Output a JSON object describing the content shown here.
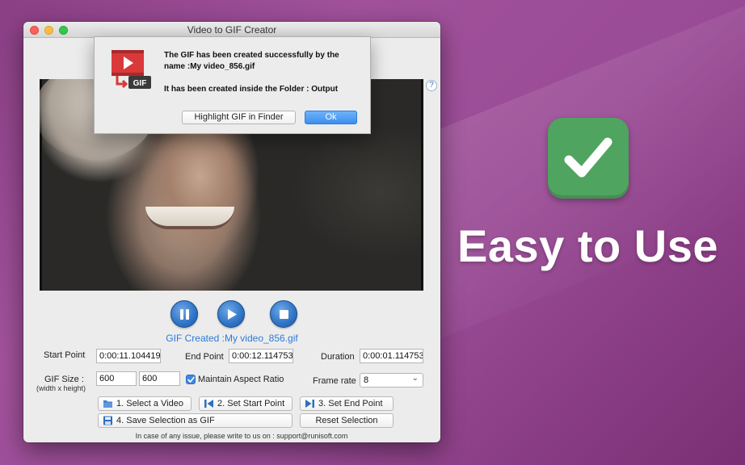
{
  "promo": {
    "title": "Easy to Use",
    "check_color": "#4fa45f",
    "icon": "checkmark-icon"
  },
  "window": {
    "title": "Video to GIF Creator",
    "help_label": "?"
  },
  "controls": {
    "pause_icon": "pause-icon",
    "play_icon": "play-icon",
    "stop_icon": "stop-icon",
    "accent_color": "#2e73c6"
  },
  "status": {
    "text": "GIF Created :My video_856.gif"
  },
  "form": {
    "start_point_label": "Start Point",
    "start_point_value": "0:00:11.104419",
    "end_point_label": "End Point",
    "end_point_value": "0:00:12.114753",
    "duration_label": "Duration",
    "duration_value": "0:00:01.114753",
    "gif_size_label": "GIF Size :",
    "gif_size_sublabel": "(width x height)",
    "width_value": "600",
    "height_value": "600",
    "maintain_aspect_label": "Maintain Aspect Ratio",
    "maintain_aspect_checked": true,
    "frame_rate_label": "Frame rate",
    "frame_rate_value": "8"
  },
  "buttons": {
    "select_video": "1. Select a Video",
    "set_start": "2. Set Start Point",
    "set_end": "3. Set End Point",
    "save_selection": "4. Save Selection as GIF",
    "reset_selection": "Reset Selection"
  },
  "footer": {
    "note": "In case of any issue, please write to us on : support@runisoft.com"
  },
  "alert": {
    "line1": "The GIF has been created successfully by the name :My video_856.gif",
    "line2": "It has been created inside the Folder : Output",
    "secondary_button": "Highlight GIF in Finder",
    "primary_button": "Ok",
    "icon": "video-to-gif-app-icon",
    "icon_badge": "GIF"
  }
}
